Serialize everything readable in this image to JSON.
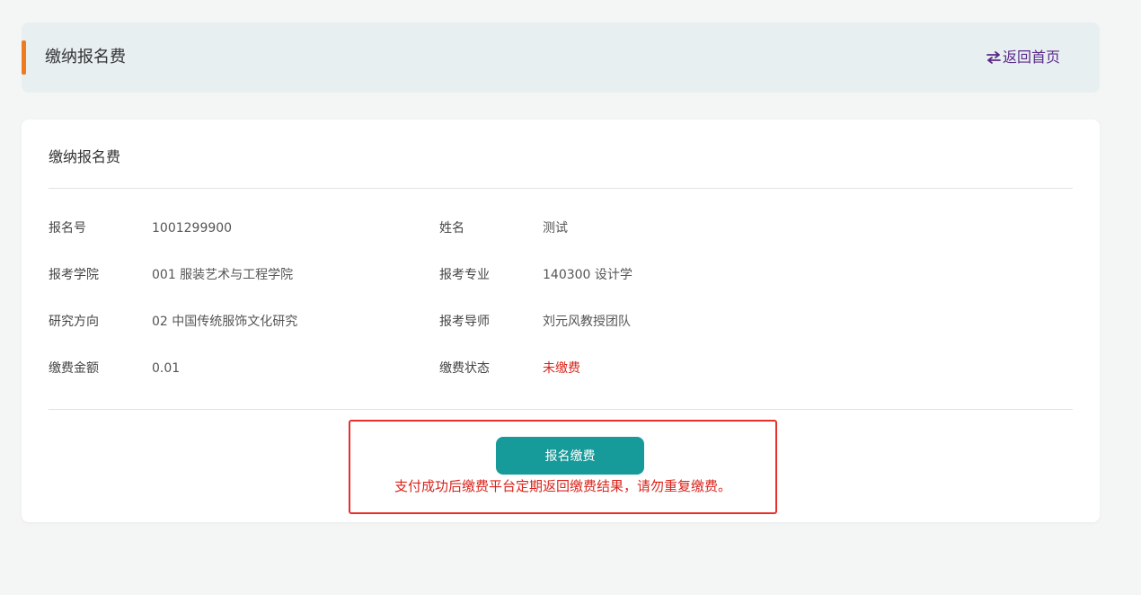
{
  "header": {
    "title": "缴纳报名费",
    "back_label": "返回首页"
  },
  "card": {
    "title": "缴纳报名费",
    "rows": [
      {
        "left_label": "报名号",
        "left_value": "1001299900",
        "right_label": "姓名",
        "right_value": "测试"
      },
      {
        "left_label": "报考学院",
        "left_value": "001 服装艺术与工程学院",
        "right_label": "报考专业",
        "right_value": "140300 设计学"
      },
      {
        "left_label": "研究方向",
        "left_value": "02 中国传统服饰文化研究",
        "right_label": "报考导师",
        "right_value": "刘元风教授团队"
      },
      {
        "left_label": "缴费金额",
        "left_value": "0.01",
        "right_label": "缴费状态",
        "right_value": "未缴费"
      }
    ],
    "pay_button_label": "报名缴费",
    "pay_notice": "支付成功后缴费平台定期返回缴费结果，请勿重复缴费。"
  },
  "colors": {
    "accent": "#f07a1e",
    "button": "#169a9a",
    "link": "#5a2a8a",
    "warning": "#d9251d"
  },
  "icons": {
    "back": "swap-arrows-icon"
  }
}
